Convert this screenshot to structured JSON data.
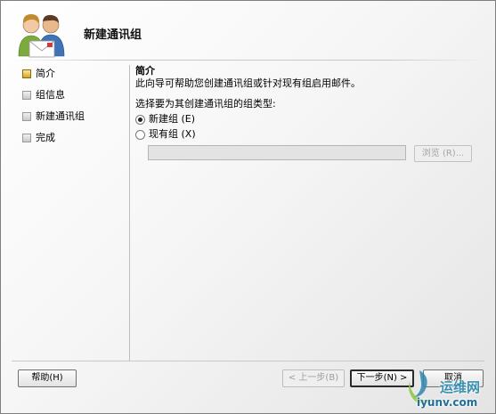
{
  "window": {
    "title": "新建通讯组"
  },
  "nav": {
    "items": [
      {
        "label": "简介",
        "active": true
      },
      {
        "label": "组信息",
        "active": false
      },
      {
        "label": "新建通讯组",
        "active": false
      },
      {
        "label": "完成",
        "active": false
      }
    ]
  },
  "content": {
    "section_title": "简介",
    "intro": "此向导可帮助您创建通讯组或针对现有组启用邮件。",
    "prompt": "选择要为其创建通讯组的组类型:",
    "options": [
      {
        "label": "新建组 (E)",
        "checked": true
      },
      {
        "label": "现有组 (X)",
        "checked": false
      }
    ],
    "existing_group_value": "",
    "browse_label": "浏览 (R)..."
  },
  "buttons": {
    "help": "帮助(H)",
    "back": "< 上一步(B)",
    "next": "下一步(N) >",
    "cancel": "取消"
  },
  "watermark": {
    "name": "运维网",
    "url": "iyunv.com"
  },
  "colors": {
    "nav_active": "#e0a820",
    "watermark": "#2e86b0"
  },
  "icons": {
    "header": "users-icon",
    "watermark": "swirl-logo-icon"
  }
}
